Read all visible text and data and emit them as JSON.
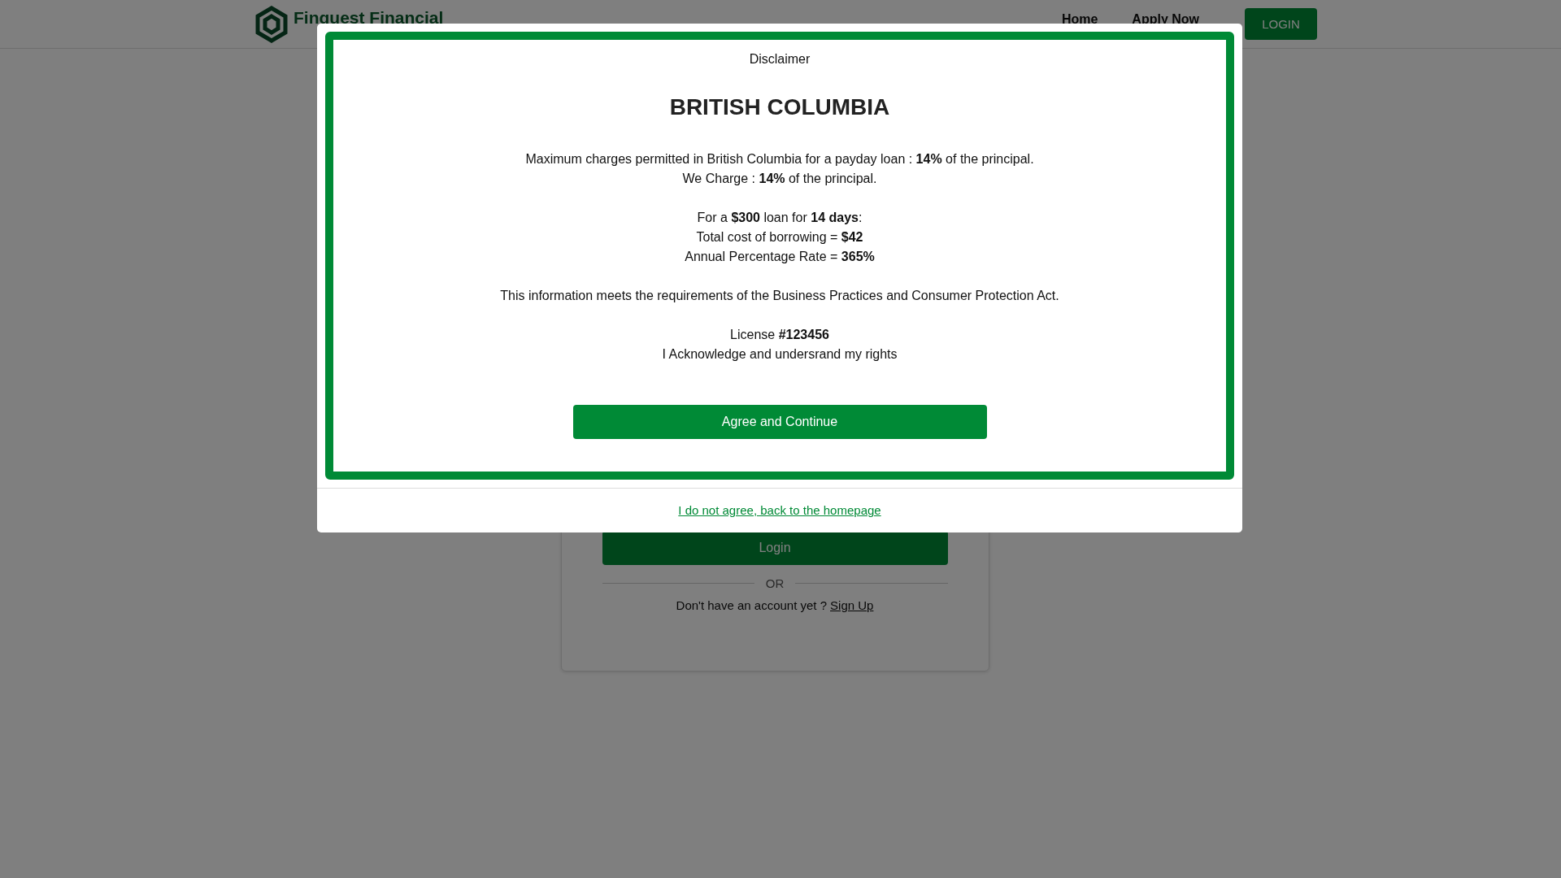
{
  "header": {
    "logo_text": "Finquest Financial",
    "nav": [
      {
        "label": "Home"
      },
      {
        "label": "Apply Now"
      }
    ],
    "login_button": "LOGIN"
  },
  "login_card": {
    "submit": "Login",
    "divider": "OR",
    "signup_prompt": "Don't have an account yet ?",
    "signup_link": "Sign Up"
  },
  "modal": {
    "heading": "Disclaimer",
    "title": "BRITISH COLUMBIA",
    "paragraphs": [
      [
        "Maximum charges permitted in British Columbia for a payday loan : **14%** of the principal.",
        "We Charge : **14%** of the principal."
      ],
      [
        "For a **$300** loan for **14 days**:",
        "Total cost of borrowing = **$42**",
        "Annual Percentage Rate = **365%**"
      ],
      [
        "This information meets the requirements of the Business Practices and Consumer Protection Act."
      ],
      [
        "License **#123456**",
        "I Acknowledge and undersrand my rights"
      ]
    ],
    "agree_button": "Agree and Continue",
    "decline_link": "I do not agree, back to the homepage"
  }
}
